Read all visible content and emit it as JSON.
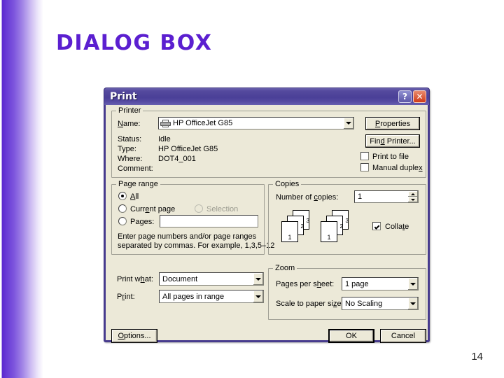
{
  "slide": {
    "title": "DIALOG BOX",
    "page_number": "14",
    "accent_color": "#5b1fd0"
  },
  "dialog": {
    "title": "Print",
    "help_button": "?",
    "close_button": "✕",
    "printer": {
      "legend": "Printer",
      "name_label": "Name:",
      "name_value": "HP OfficeJet G85",
      "printer_icon": "printer-icon",
      "status_label": "Status:",
      "status_value": "Idle",
      "type_label": "Type:",
      "type_value": "HP OfficeJet G85",
      "where_label": "Where:",
      "where_value": "DOT4_001",
      "comment_label": "Comment:",
      "comment_value": "",
      "properties_button": "Properties",
      "find_printer_button": "Find Printer...",
      "print_to_file_label": "Print to file",
      "print_to_file_checked": false,
      "manual_duplex_label": "Manual duplex",
      "manual_duplex_checked": false
    },
    "page_range": {
      "legend": "Page range",
      "all_label": "All",
      "all_selected": true,
      "current_page_label": "Current page",
      "current_page_selected": false,
      "selection_label": "Selection",
      "selection_disabled": true,
      "pages_label": "Pages:",
      "pages_selected": false,
      "pages_value": "",
      "hint_line1": "Enter page numbers and/or page ranges",
      "hint_line2": "separated by commas.  For example, 1,3,5–12"
    },
    "copies": {
      "legend": "Copies",
      "number_label": "Number of copies:",
      "number_value": "1",
      "collate_label": "Collate",
      "collate_checked": true,
      "page_marks": [
        "1",
        "2",
        "3"
      ]
    },
    "print_what": {
      "label": "Print what:",
      "value": "Document"
    },
    "print_range": {
      "label": "Print:",
      "value": "All pages in range"
    },
    "zoom": {
      "legend": "Zoom",
      "pages_per_sheet_label": "Pages per sheet:",
      "pages_per_sheet_value": "1 page",
      "scale_label": "Scale to paper size:",
      "scale_value": "No Scaling"
    },
    "footer": {
      "options_button": "Options...",
      "ok_button": "OK",
      "cancel_button": "Cancel"
    }
  }
}
